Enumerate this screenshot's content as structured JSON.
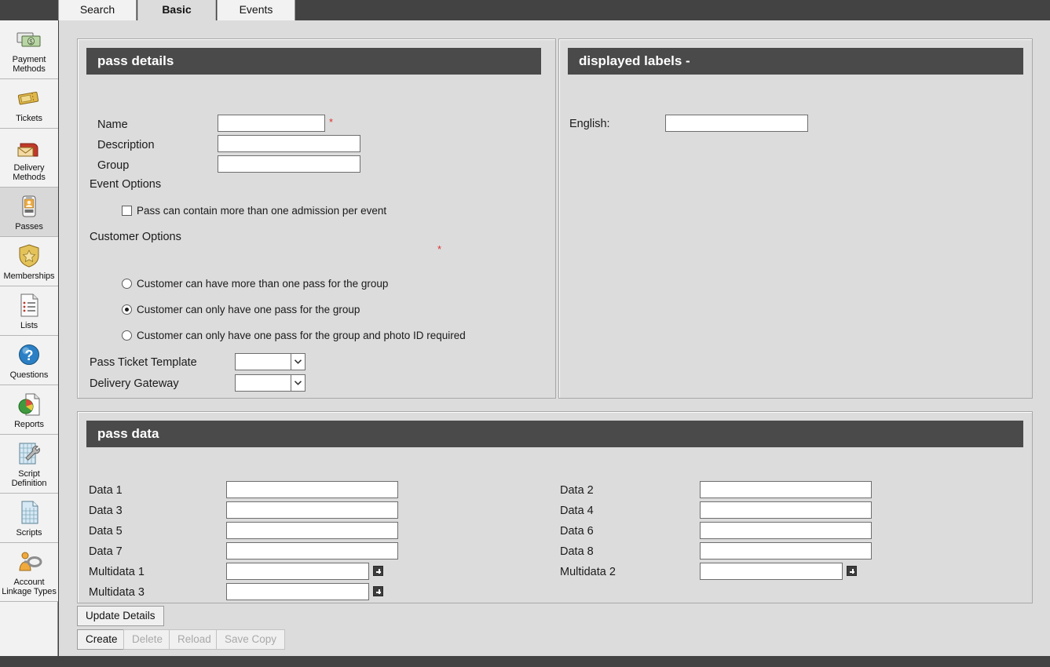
{
  "tabs": [
    {
      "label": "Search",
      "active": false
    },
    {
      "label": "Basic",
      "active": true
    },
    {
      "label": "Events",
      "active": false
    }
  ],
  "sidebar": {
    "items": [
      {
        "label1": "Payment",
        "label2": "Methods",
        "icon": "banknotes-icon",
        "active": false
      },
      {
        "label1": "Tickets",
        "label2": "",
        "icon": "tickets-icon",
        "active": false
      },
      {
        "label1": "Delivery",
        "label2": "Methods",
        "icon": "mailbox-icon",
        "active": false
      },
      {
        "label1": "Passes",
        "label2": "",
        "icon": "id-badge-icon",
        "active": true
      },
      {
        "label1": "Memberships",
        "label2": "",
        "icon": "shield-star-icon",
        "active": false
      },
      {
        "label1": "Lists",
        "label2": "",
        "icon": "list-document-icon",
        "active": false
      },
      {
        "label1": "Questions",
        "label2": "",
        "icon": "question-mark-icon",
        "active": false
      },
      {
        "label1": "Reports",
        "label2": "",
        "icon": "pie-chart-report-icon",
        "active": false
      },
      {
        "label1": "Script",
        "label2": "Definition",
        "icon": "grid-wrench-icon",
        "active": false
      },
      {
        "label1": "Scripts",
        "label2": "",
        "icon": "grid-document-icon",
        "active": false
      },
      {
        "label1": "Account",
        "label2": "Linkage Types",
        "icon": "account-link-icon",
        "active": false
      }
    ]
  },
  "pass_details": {
    "title": "pass details",
    "name_label": "Name",
    "name_value": "",
    "name_required": "*",
    "description_label": "Description",
    "description_value": "",
    "group_label": "Group",
    "group_value": "",
    "event_options_label": "Event Options",
    "multi_admission_label": "Pass can contain more than one admission per event",
    "multi_admission_checked": false,
    "customer_options_label": "Customer Options",
    "customer_options_required": "*",
    "customer_options": [
      {
        "label": "Customer can have more than one pass for the group",
        "selected": false
      },
      {
        "label": "Customer can only have one pass for the group",
        "selected": true
      },
      {
        "label": "Customer can only have one pass for the group and photo ID required",
        "selected": false
      }
    ],
    "pass_ticket_template_label": "Pass Ticket Template",
    "pass_ticket_template_value": "",
    "delivery_gateway_label": "Delivery Gateway",
    "delivery_gateway_value": ""
  },
  "displayed_labels": {
    "title": "displayed labels -",
    "english_label": "English:",
    "english_value": ""
  },
  "pass_data": {
    "title": "pass data",
    "left_fields": [
      {
        "label": "Data 1",
        "value": "",
        "multi": false
      },
      {
        "label": "Data 3",
        "value": "",
        "multi": false
      },
      {
        "label": "Data 5",
        "value": "",
        "multi": false
      },
      {
        "label": "Data 7",
        "value": "",
        "multi": false
      },
      {
        "label": "Multidata 1",
        "value": "",
        "multi": true
      },
      {
        "label": "Multidata 3",
        "value": "",
        "multi": true
      }
    ],
    "right_fields": [
      {
        "label": "Data 2",
        "value": "",
        "multi": false
      },
      {
        "label": "Data 4",
        "value": "",
        "multi": false
      },
      {
        "label": "Data 6",
        "value": "",
        "multi": false
      },
      {
        "label": "Data 8",
        "value": "",
        "multi": false
      },
      {
        "label": "Multidata 2",
        "value": "",
        "multi": true
      }
    ]
  },
  "actions": {
    "update_details": {
      "label": "Update Details",
      "disabled": false
    },
    "create": {
      "label": "Create",
      "disabled": false
    },
    "delete": {
      "label": "Delete",
      "disabled": true
    },
    "reload": {
      "label": "Reload",
      "disabled": true
    },
    "save_copy": {
      "label": "Save Copy",
      "disabled": true
    }
  },
  "colors": {
    "topbar": "#434343",
    "panel_header": "#4a4a4a",
    "content_bg": "#dcdcdc",
    "sidebar_bg": "#f2f2f2",
    "sidebar_active": "#d8d8d8",
    "required_asterisk": "#e03030"
  }
}
